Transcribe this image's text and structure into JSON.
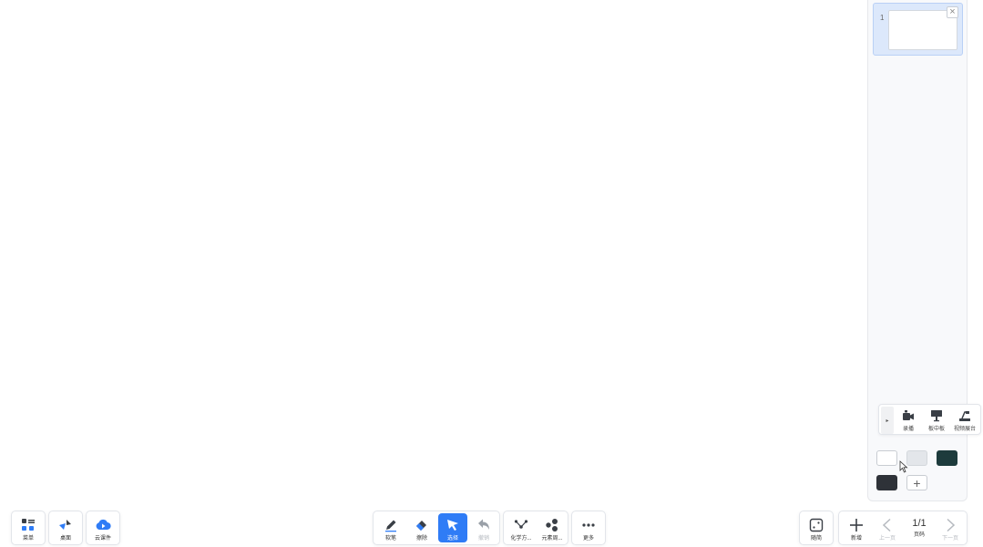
{
  "pages": {
    "items": [
      {
        "number": "1"
      }
    ],
    "close_glyph": "×"
  },
  "media": {
    "toggle_glyph": "▸",
    "items": [
      {
        "label": "录播",
        "icon": "video-camera-icon"
      },
      {
        "label": "板中板",
        "icon": "presentation-board-icon"
      },
      {
        "label": "视频展台",
        "icon": "document-camera-icon"
      }
    ]
  },
  "colors": {
    "swatches": [
      "#ffffff",
      "#e3e6ea",
      "#1d3b3c",
      "#2e3238"
    ],
    "add_glyph": "+"
  },
  "left_toolbar": {
    "menu": "菜单",
    "desktop": "桌面",
    "cloud": "云课件"
  },
  "center_toolbar": {
    "pen": "软笔",
    "eraser": "擦除",
    "select": "选择",
    "undo": "撤销",
    "chemistry": "化学方...",
    "periodic": "元素周...",
    "more": "更多"
  },
  "right_toolbar": {
    "random": "随简",
    "new": "新增",
    "prev": "上一页",
    "page_indicator": "1/1",
    "page_label": "页码",
    "next": "下一页"
  },
  "accent_color": "#2f7cf6"
}
